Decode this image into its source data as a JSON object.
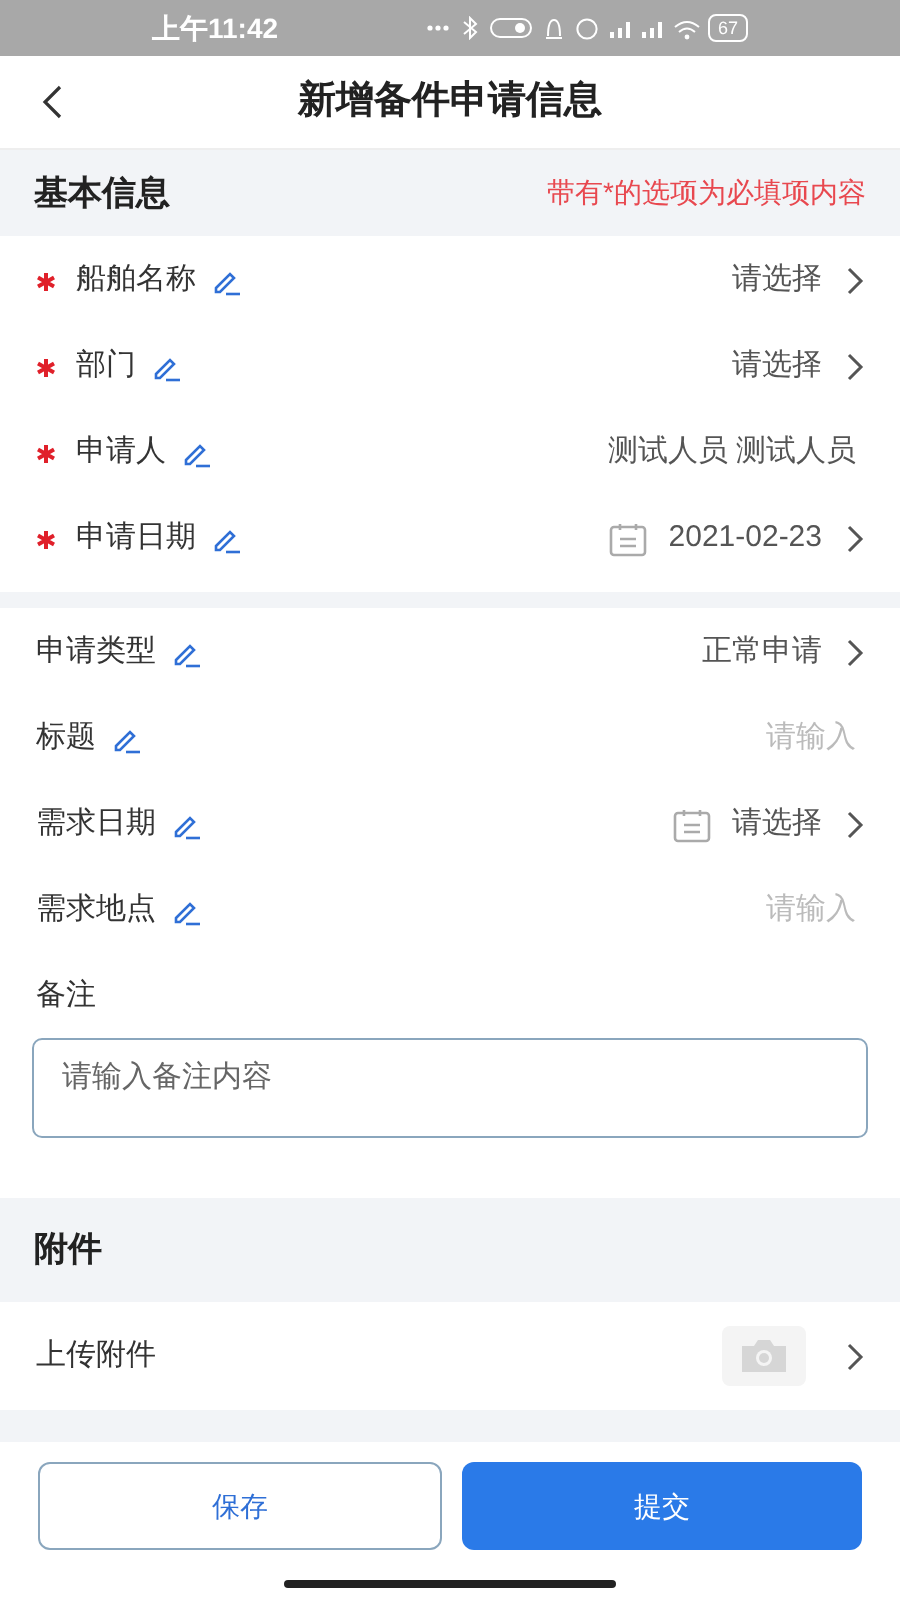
{
  "status_bar": {
    "time": "上午11:42",
    "battery": "67"
  },
  "header": {
    "title": "新增备件申请信息"
  },
  "basic_section": {
    "title": "基本信息",
    "hint": "带有*的选项为必填项内容"
  },
  "required_fields": [
    {
      "label": "船舶名称",
      "required": true,
      "kind": "select",
      "placeholder": "请选择"
    },
    {
      "label": "部门",
      "required": true,
      "kind": "select",
      "placeholder": "请选择"
    },
    {
      "label": "申请人",
      "required": true,
      "kind": "readonly",
      "value": "测试人员 测试人员"
    },
    {
      "label": "申请日期",
      "required": true,
      "kind": "date",
      "value": "2021-02-23"
    }
  ],
  "optional_fields": [
    {
      "label": "申请类型",
      "required": false,
      "kind": "select",
      "value": "正常申请"
    },
    {
      "label": "标题",
      "required": false,
      "kind": "input",
      "placeholder": "请输入"
    },
    {
      "label": "需求日期",
      "required": false,
      "kind": "date",
      "placeholder": "请选择"
    },
    {
      "label": "需求地点",
      "required": false,
      "kind": "input",
      "placeholder": "请输入"
    }
  ],
  "remarks": {
    "label": "备注",
    "placeholder": "请输入备注内容"
  },
  "attachment_section": {
    "title": "附件",
    "upload_label": "上传附件"
  },
  "buttons": [
    {
      "label": "保存",
      "kind": "secondary"
    },
    {
      "label": "提交",
      "kind": "primary"
    }
  ]
}
